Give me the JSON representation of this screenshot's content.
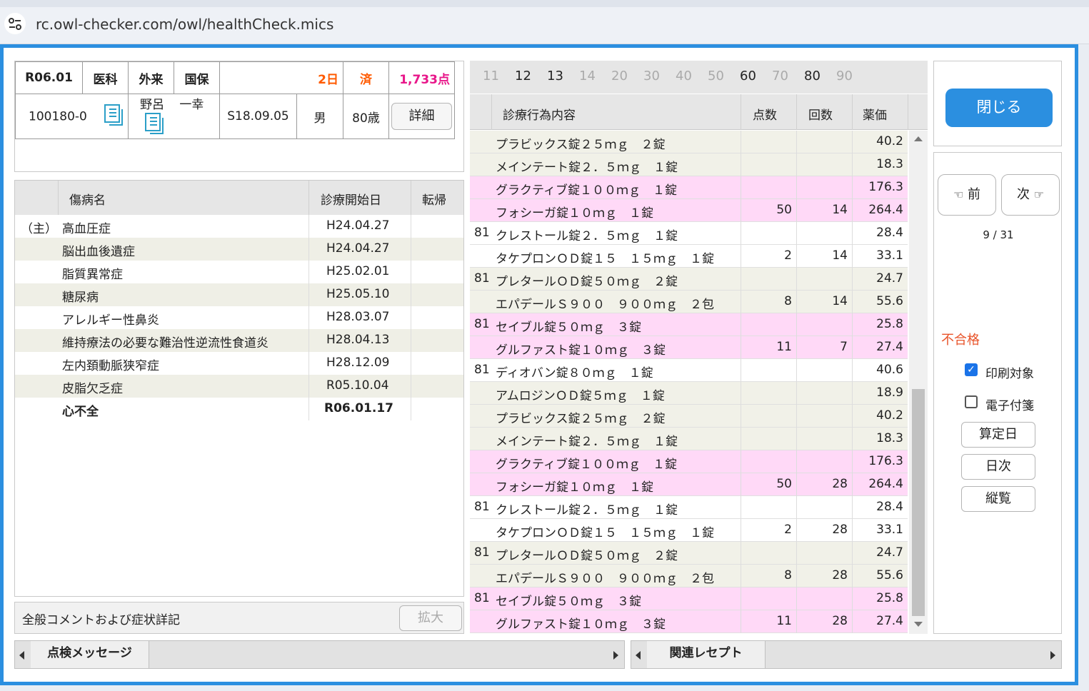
{
  "browser": {
    "url": "rc.owl-checker.com/owl/healthCheck.mics"
  },
  "patient": {
    "era_month": "R06.01",
    "dept": "医科",
    "visit_type": "外来",
    "insurance": "国保",
    "days": "2日",
    "done": "済",
    "points": "1,733点",
    "id": "100180-0",
    "surname": "野呂",
    "given": "一幸",
    "birth": "S18.09.05",
    "sex": "男",
    "age": "80歳",
    "detail_button": "詳細"
  },
  "diagnoses": {
    "headers": {
      "name": "傷病名",
      "start": "診療開始日",
      "outcome": "転帰"
    },
    "rows": [
      {
        "mark": "（主）",
        "name": "高血圧症",
        "date": "H24.04.27"
      },
      {
        "mark": "",
        "name": "脳出血後遺症",
        "date": "H24.04.27"
      },
      {
        "mark": "",
        "name": "脂質異常症",
        "date": "H25.02.01"
      },
      {
        "mark": "",
        "name": "糖尿病",
        "date": "H25.05.10"
      },
      {
        "mark": "",
        "name": "アレルギー性鼻炎",
        "date": "H28.03.07"
      },
      {
        "mark": "",
        "name": "維持療法の必要な難治性逆流性食道炎",
        "date": "H28.04.13"
      },
      {
        "mark": "",
        "name": "左内頚動脈狭窄症",
        "date": "H28.12.09"
      },
      {
        "mark": "",
        "name": "皮脂欠乏症",
        "date": "R05.10.04"
      },
      {
        "mark": "",
        "name": "心不全",
        "date": "R06.01.17"
      }
    ]
  },
  "comment": {
    "label": "全般コメントおよび症状詳記",
    "expand_button": "拡大"
  },
  "page_tabs": [
    "11",
    "12",
    "13",
    "14",
    "20",
    "30",
    "40",
    "50",
    "60",
    "70",
    "80",
    "90"
  ],
  "procedures": {
    "headers": {
      "content": "診療行為内容",
      "points": "点数",
      "count": "回数",
      "price": "薬価"
    },
    "rows": [
      {
        "code": "",
        "name": "プラビックス錠２５ｍｇ　２錠",
        "points": "",
        "count": "",
        "price": "40.2",
        "bg": "#f1f1e8"
      },
      {
        "code": "",
        "name": "メインテート錠２．５ｍｇ　１錠",
        "points": "",
        "count": "",
        "price": "18.3",
        "bg": "#f1f1e8"
      },
      {
        "code": "",
        "name": "グラクティブ錠１００ｍｇ　１錠",
        "points": "",
        "count": "",
        "price": "176.3",
        "bg": "#ffd9f7"
      },
      {
        "code": "",
        "name": "フォシーガ錠１０ｍｇ　１錠",
        "points": "50",
        "count": "14",
        "price": "264.4",
        "bg": "#ffd9f7"
      },
      {
        "code": "81",
        "name": "クレストール錠２．５ｍｇ　１錠",
        "points": "",
        "count": "",
        "price": "28.4",
        "bg": "#ffffff"
      },
      {
        "code": "",
        "name": "タケプロンＯＤ錠１５　１５ｍｇ　１錠",
        "points": "2",
        "count": "14",
        "price": "33.1",
        "bg": "#ffffff"
      },
      {
        "code": "81",
        "name": "プレタールＯＤ錠５０ｍｇ　２錠",
        "points": "",
        "count": "",
        "price": "24.7",
        "bg": "#f1f1e8"
      },
      {
        "code": "",
        "name": "エパデールＳ９００　９００ｍｇ　２包",
        "points": "8",
        "count": "14",
        "price": "55.6",
        "bg": "#f1f1e8"
      },
      {
        "code": "81",
        "name": "セイブル錠５０ｍｇ　３錠",
        "points": "",
        "count": "",
        "price": "25.8",
        "bg": "#ffd9f7"
      },
      {
        "code": "",
        "name": "グルファスト錠１０ｍｇ　３錠",
        "points": "11",
        "count": "7",
        "price": "27.4",
        "bg": "#ffd9f7"
      },
      {
        "code": "81",
        "name": "ディオバン錠８０ｍｇ　１錠",
        "points": "",
        "count": "",
        "price": "40.6",
        "bg": "#ffffff"
      },
      {
        "code": "",
        "name": "アムロジンＯＤ錠５ｍｇ　１錠",
        "points": "",
        "count": "",
        "price": "18.9",
        "bg": "#f1f1e8"
      },
      {
        "code": "",
        "name": "プラビックス錠２５ｍｇ　２錠",
        "points": "",
        "count": "",
        "price": "40.2",
        "bg": "#f1f1e8"
      },
      {
        "code": "",
        "name": "メインテート錠２．５ｍｇ　１錠",
        "points": "",
        "count": "",
        "price": "18.3",
        "bg": "#f1f1e8"
      },
      {
        "code": "",
        "name": "グラクティブ錠１００ｍｇ　１錠",
        "points": "",
        "count": "",
        "price": "176.3",
        "bg": "#ffd9f7"
      },
      {
        "code": "",
        "name": "フォシーガ錠１０ｍｇ　１錠",
        "points": "50",
        "count": "28",
        "price": "264.4",
        "bg": "#ffd9f7"
      },
      {
        "code": "81",
        "name": "クレストール錠２．５ｍｇ　１錠",
        "points": "",
        "count": "",
        "price": "28.4",
        "bg": "#ffffff"
      },
      {
        "code": "",
        "name": "タケプロンＯＤ錠１５　１５ｍｇ　１錠",
        "points": "2",
        "count": "28",
        "price": "33.1",
        "bg": "#ffffff"
      },
      {
        "code": "81",
        "name": "プレタールＯＤ錠５０ｍｇ　２錠",
        "points": "",
        "count": "",
        "price": "24.7",
        "bg": "#f1f1e8"
      },
      {
        "code": "",
        "name": "エパデールＳ９００　９００ｍｇ　２包",
        "points": "8",
        "count": "28",
        "price": "55.6",
        "bg": "#f1f1e8"
      },
      {
        "code": "81",
        "name": "セイブル錠５０ｍｇ　３錠",
        "points": "",
        "count": "",
        "price": "25.8",
        "bg": "#ffd9f7"
      },
      {
        "code": "",
        "name": "グルファスト錠１０ｍｇ　３錠",
        "points": "11",
        "count": "28",
        "price": "27.4",
        "bg": "#ffd9f7"
      }
    ]
  },
  "side": {
    "close_button": "閉じる",
    "prev_button": "前",
    "next_button": "次",
    "pager": "9 / 31",
    "status": "不合格",
    "print_label": "印刷対象",
    "print_checked": true,
    "etag_label": "電子付箋",
    "etag_checked": false,
    "calc_day_button": "算定日",
    "daily_button": "日次",
    "vertical_button": "縦覧"
  },
  "bottom": {
    "check_messages": "点検メッセージ",
    "related": "関連レセプト"
  },
  "colors": {
    "accent": "#2b8fe0",
    "alert": "#ff5a00",
    "points": "#e8178a",
    "fail": "#e8542a"
  }
}
